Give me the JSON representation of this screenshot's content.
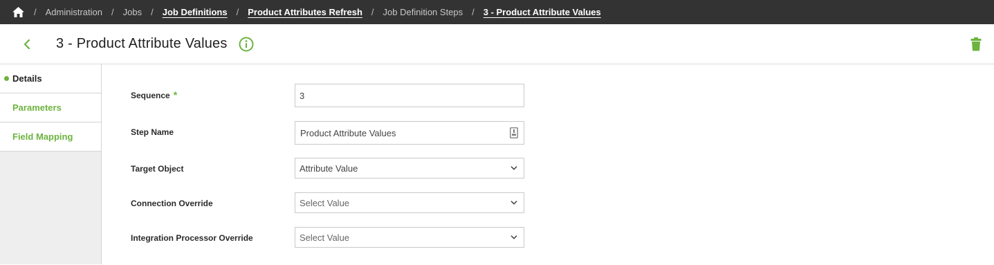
{
  "breadcrumb": {
    "items": [
      {
        "label": "Administration",
        "link": false
      },
      {
        "label": "Jobs",
        "link": false
      },
      {
        "label": "Job Definitions",
        "link": true
      },
      {
        "label": "Product Attributes Refresh",
        "link": true
      },
      {
        "label": "Job Definition Steps",
        "link": false
      },
      {
        "label": "3 - Product Attribute Values",
        "link": true
      }
    ],
    "separator": "/"
  },
  "header": {
    "title": "3 - Product Attribute Values"
  },
  "sidebar": {
    "items": [
      {
        "label": "Details",
        "active": true
      },
      {
        "label": "Parameters",
        "active": false
      },
      {
        "label": "Field Mapping",
        "active": false
      }
    ]
  },
  "form": {
    "sequence": {
      "label": "Sequence",
      "required_mark": "*",
      "value": "3"
    },
    "step_name": {
      "label": "Step Name",
      "value": "Product Attribute Values"
    },
    "target_object": {
      "label": "Target Object",
      "value": "Attribute Value"
    },
    "connection_override": {
      "label": "Connection Override",
      "value": "Select Value"
    },
    "integration_processor_override": {
      "label": "Integration Processor Override",
      "value": "Select Value"
    }
  },
  "colors": {
    "accent": "#6cb33f",
    "topbar": "#333333",
    "sidebar_bg": "#eeeeee"
  },
  "icons": [
    "home-icon",
    "back-chevron-icon",
    "info-icon",
    "trash-icon",
    "context-menu-icon",
    "chevron-down-icon"
  ]
}
